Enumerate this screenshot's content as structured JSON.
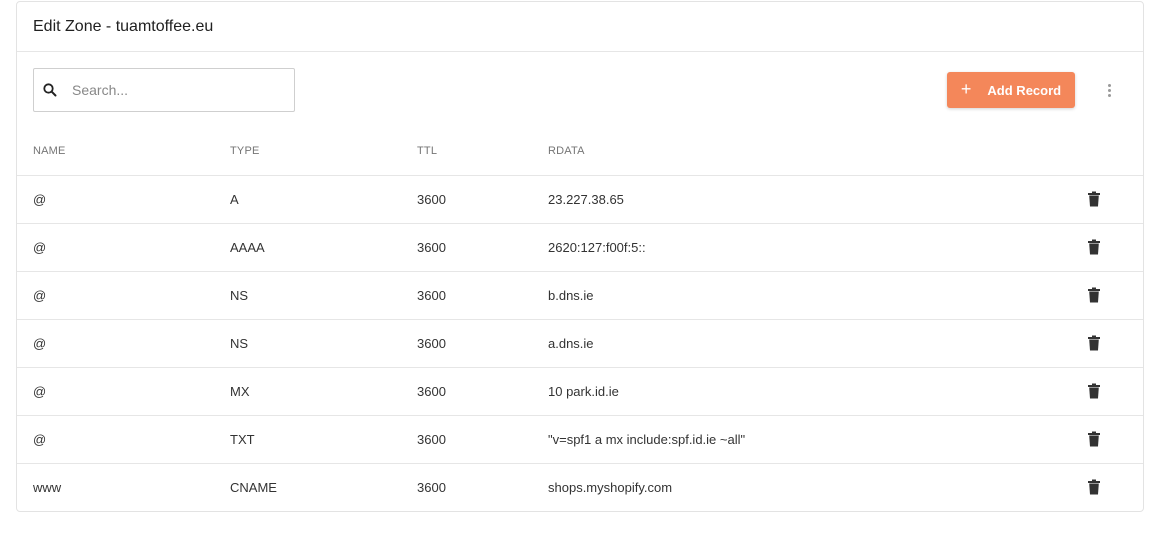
{
  "header": {
    "title": "Edit Zone - tuamtoffee.eu"
  },
  "search": {
    "placeholder": "Search...",
    "value": "",
    "icon": "search-icon"
  },
  "toolbar": {
    "add_label": "Add Record",
    "add_icon": "plus-icon",
    "more_icon": "more-vert-icon",
    "accent": "#f4875a"
  },
  "table": {
    "columns": [
      "NAME",
      "TYPE",
      "TTL",
      "RDATA"
    ],
    "rows": [
      {
        "name": "@",
        "type": "A",
        "ttl": "3600",
        "rdata": "23.227.38.65"
      },
      {
        "name": "@",
        "type": "AAAA",
        "ttl": "3600",
        "rdata": "2620:127:f00f:5::"
      },
      {
        "name": "@",
        "type": "NS",
        "ttl": "3600",
        "rdata": "b.dns.ie"
      },
      {
        "name": "@",
        "type": "NS",
        "ttl": "3600",
        "rdata": "a.dns.ie"
      },
      {
        "name": "@",
        "type": "MX",
        "ttl": "3600",
        "rdata": "10 park.id.ie"
      },
      {
        "name": "@",
        "type": "TXT",
        "ttl": "3600",
        "rdata": "\"v=spf1 a mx include:spf.id.ie ~all\""
      },
      {
        "name": "www",
        "type": "CNAME",
        "ttl": "3600",
        "rdata": "shops.myshopify.com"
      }
    ],
    "row_action_icon": "trash-icon"
  }
}
